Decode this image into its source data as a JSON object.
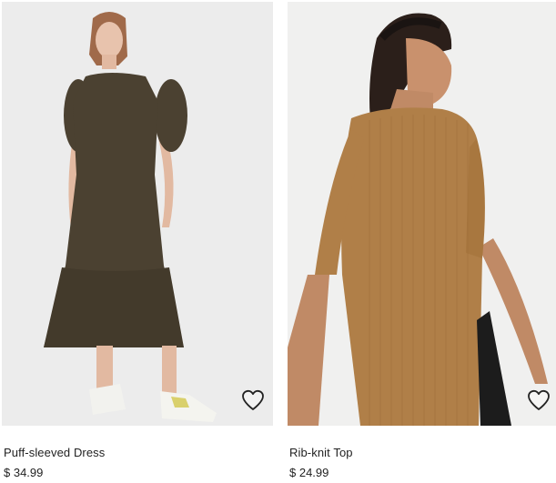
{
  "products": [
    {
      "name": "Puff-sleeved Dress",
      "price": "$ 34.99",
      "image_bg": "#ececec",
      "garment_color": "#4b4131",
      "favorite_icon": "heart-outline-icon"
    },
    {
      "name": "Rib-knit Top",
      "price": "$ 24.99",
      "image_bg": "#f0f0ef",
      "garment_color": "#b07f48",
      "favorite_icon": "heart-outline-icon"
    }
  ]
}
